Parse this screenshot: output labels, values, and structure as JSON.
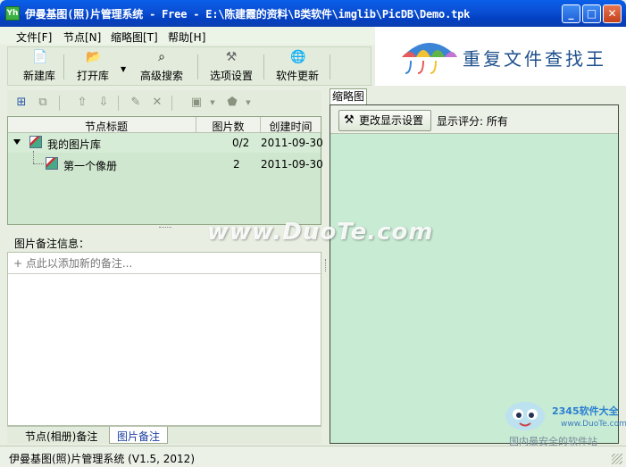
{
  "window": {
    "title": "伊曼基图(照)片管理系统 - Free - E:\\陈建霞的资料\\B类软件\\imglib\\PicDB\\Demo.tpk",
    "app_icon": "Yh",
    "minimize": "_",
    "maximize": "□",
    "close": "✕"
  },
  "menu": [
    {
      "label": "文件[F]"
    },
    {
      "label": "节点[N]"
    },
    {
      "label": "缩略图[T]"
    },
    {
      "label": "帮助[H]"
    }
  ],
  "toolbar": {
    "new_label": "新建库",
    "open_label": "打开库",
    "search_label": "高级搜索",
    "options_label": "选项设置",
    "update_label": "软件更新"
  },
  "banner": {
    "text": "重复文件查找王",
    "umbrella_colors": [
      "#3b84d6",
      "#e55a5a",
      "#f1c232",
      "#62b446",
      "#c274d0"
    ]
  },
  "tree": {
    "columns": [
      "节点标题",
      "图片数",
      "创建时间"
    ],
    "rows": [
      {
        "title": "我的图片库",
        "count": "0/2",
        "date": "2011-09-30"
      },
      {
        "title": "第一个像册",
        "count": "2",
        "date": "2011-09-30"
      }
    ]
  },
  "notes": {
    "label": "图片备注信息：",
    "placeholder": "+ 点此以添加新的备注..."
  },
  "bottom_tabs": [
    {
      "label": "节点(相册)备注"
    },
    {
      "label": "图片备注"
    }
  ],
  "right": {
    "tab_label": "缩略图",
    "change_button": "更改显示设置",
    "rating_label": "显示评分:",
    "rating_value": "所有"
  },
  "watermark": {
    "text": "www.DuoTe.com",
    "logo_text": "2345软件大全",
    "logo_url": "www.DuoTe.com",
    "logo_slogan": "国内最安全的软件站"
  },
  "status": {
    "text": "伊曼基图(照)片管理系统 (V1.5, 2012)"
  }
}
